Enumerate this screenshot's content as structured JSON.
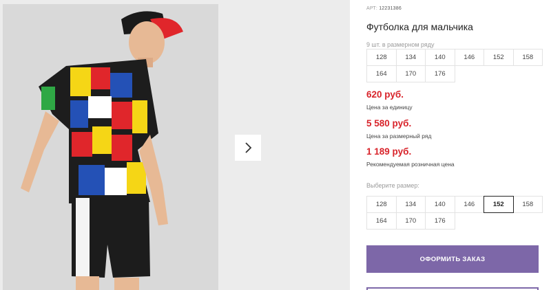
{
  "product": {
    "article_label": "АРТ:",
    "article_number": "12231386",
    "title": "Футболка для мальчика"
  },
  "pack": {
    "count_label": "9 шт. в размерном ряду",
    "sizes": [
      "128",
      "134",
      "140",
      "146",
      "152",
      "158",
      "164",
      "170",
      "176"
    ]
  },
  "prices": {
    "unit_price": "620 руб.",
    "unit_label": "Цена за единицу",
    "pack_price": "5 580 руб.",
    "pack_label": "Цена за размерный ряд",
    "retail_price": "1 189 руб.",
    "retail_label": "Рекомендуемая розничная цена"
  },
  "size_select": {
    "label": "Выберите размер:",
    "sizes": [
      "128",
      "134",
      "140",
      "146",
      "152",
      "158",
      "164",
      "170",
      "176"
    ],
    "selected": "152"
  },
  "actions": {
    "order_label": "ОФОРМИТЬ ЗАКАЗ"
  },
  "colors": {
    "price_red": "#d8232a",
    "button_purple": "#7d67a8"
  },
  "icons": {
    "next_arrow": "chevron-right-icon"
  }
}
